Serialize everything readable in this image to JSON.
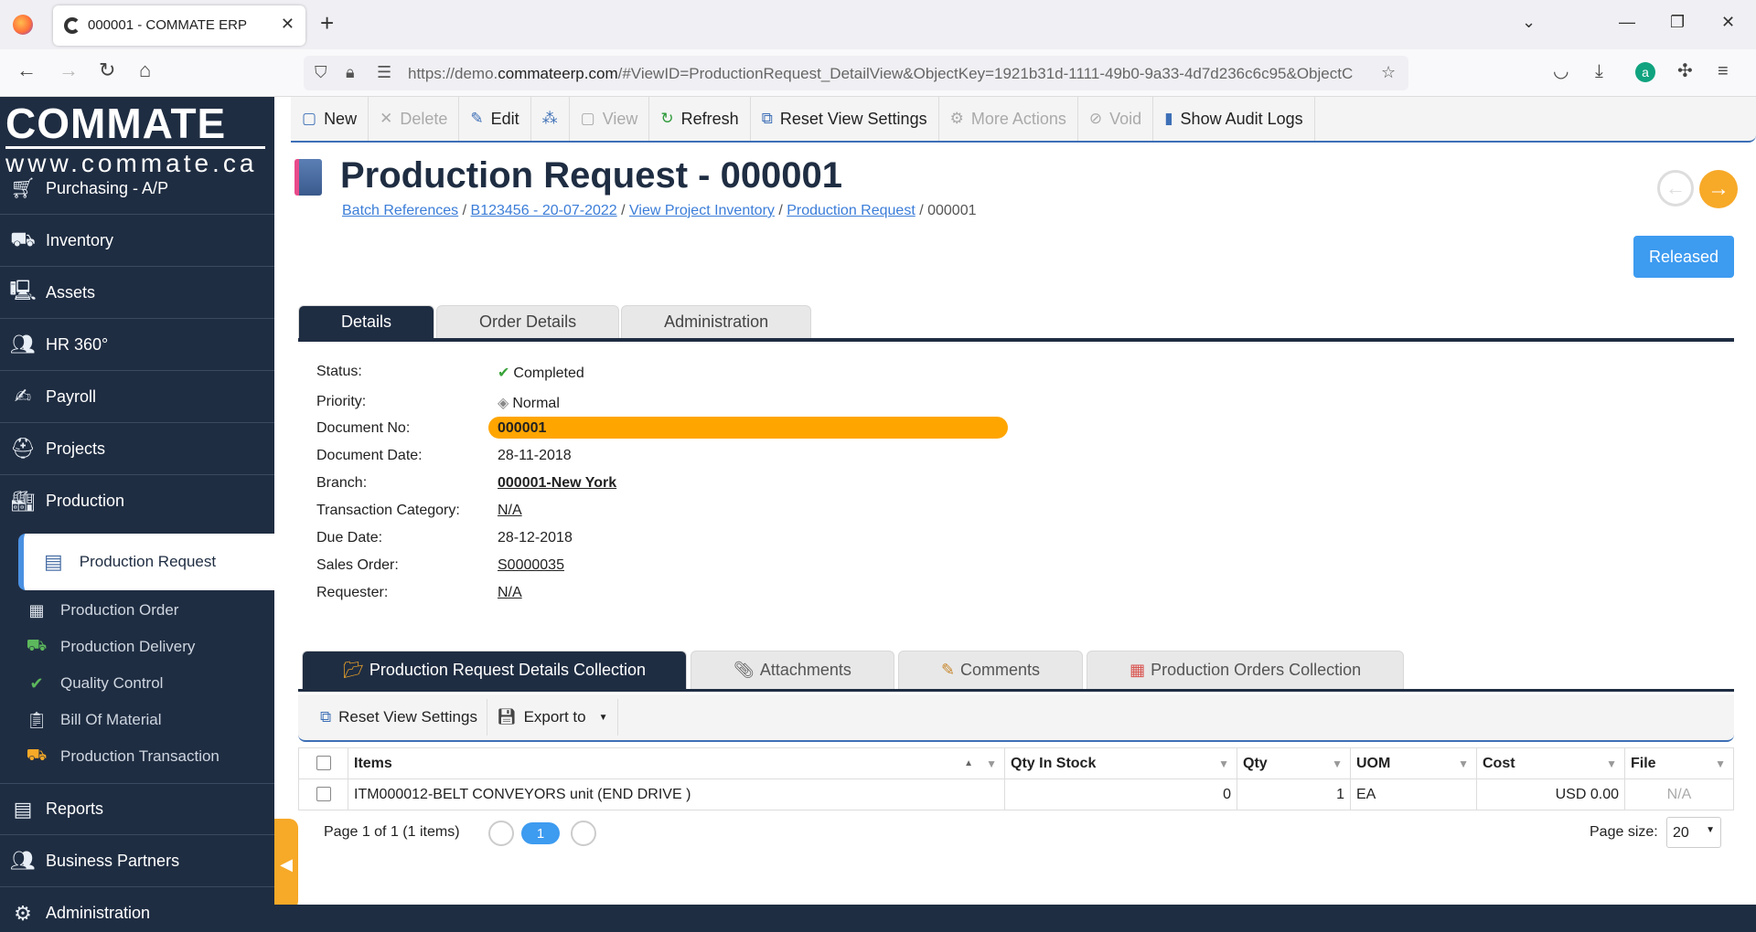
{
  "browser": {
    "tab_title": "000001 - COMMATE ERP",
    "url_prefix": "https://demo.",
    "url_domain": "commateerp.com",
    "url_rest": "/#ViewID=ProductionRequest_DetailView&ObjectKey=1921b31d-1111-49b0-9a33-4d7d236c6c95&ObjectC"
  },
  "sidebar": {
    "logo_main": "COMMATE",
    "logo_sub": "www.commate.ca",
    "items": [
      {
        "label": "Purchasing - A/P",
        "icon": "cart-icon"
      },
      {
        "label": "Inventory",
        "icon": "forklift-icon"
      },
      {
        "label": "Assets",
        "icon": "computer-icon"
      },
      {
        "label": "HR 360°",
        "icon": "people-icon"
      },
      {
        "label": "Payroll",
        "icon": "payroll-icon"
      },
      {
        "label": "Projects",
        "icon": "hardhat-icon"
      },
      {
        "label": "Production",
        "icon": "factory-icon"
      }
    ],
    "sub_active": "Production Request",
    "sub_items": [
      {
        "label": "Production Order"
      },
      {
        "label": "Production Delivery"
      },
      {
        "label": "Quality Control"
      },
      {
        "label": "Bill Of Material"
      },
      {
        "label": "Production Transaction"
      }
    ],
    "bottom_items": [
      {
        "label": "Reports"
      },
      {
        "label": "Business Partners"
      },
      {
        "label": "Administration"
      }
    ]
  },
  "toolbar": {
    "new": "New",
    "delete": "Delete",
    "edit": "Edit",
    "view": "View",
    "refresh": "Refresh",
    "reset_view": "Reset View Settings",
    "more_actions": "More Actions",
    "void": "Void",
    "audit_logs": "Show Audit Logs"
  },
  "header": {
    "title": "Production Request - 000001",
    "breadcrumb": [
      "Batch References",
      "B123456 - 20-07-2022",
      "View Project Inventory",
      "Production Request"
    ],
    "breadcrumb_current": "000001",
    "status_button": "Released"
  },
  "tabs": [
    "Details",
    "Order Details",
    "Administration"
  ],
  "fields": {
    "status_label": "Status:",
    "status_value": "Completed",
    "priority_label": "Priority:",
    "priority_value": "Normal",
    "docno_label": "Document No:",
    "docno_value": "000001",
    "docdate_label": "Document Date:",
    "docdate_value": "28-11-2018",
    "branch_label": "Branch:",
    "branch_value": "000001-New York",
    "txcat_label": "Transaction Category:",
    "txcat_value": "N/A",
    "due_label": "Due Date:",
    "due_value": "28-12-2018",
    "so_label": "Sales Order:",
    "so_value": "S0000035",
    "req_label": "Requester:",
    "req_value": "N/A"
  },
  "collection_tabs": [
    "Production Request Details Collection",
    "Attachments",
    "Comments",
    "Production Orders Collection"
  ],
  "grid_toolbar": {
    "reset": "Reset View Settings",
    "export": "Export to"
  },
  "grid": {
    "columns": [
      "Items",
      "Qty In Stock",
      "Qty",
      "UOM",
      "Cost",
      "File"
    ],
    "rows": [
      {
        "item": "ITM000012-BELT CONVEYORS unit (END DRIVE )",
        "stock": "0",
        "qty": "1",
        "uom": "EA",
        "cost": "USD 0.00",
        "file": "N/A"
      }
    ]
  },
  "pager": {
    "text": "Page 1 of 1 (1 items)",
    "page": "1",
    "size_label": "Page size:",
    "size": "20"
  }
}
